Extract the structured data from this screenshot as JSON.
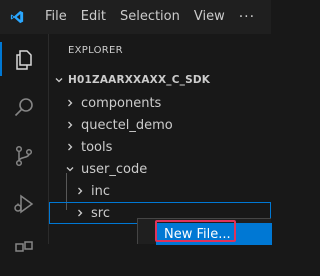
{
  "titlebar": {
    "menu": [
      "File",
      "Edit",
      "Selection",
      "View"
    ],
    "more": "···"
  },
  "activity_bar": {
    "icons": [
      "explorer-icon",
      "search-icon",
      "source-control-icon",
      "run-debug-icon",
      "extensions-icon"
    ]
  },
  "explorer": {
    "title": "EXPLORER",
    "root": "H01ZAARXXAXX_C_SDK",
    "items": [
      {
        "label": "components"
      },
      {
        "label": "quectel_demo"
      },
      {
        "label": "tools"
      },
      {
        "label": "user_code"
      },
      {
        "label": "inc"
      },
      {
        "label": "src"
      }
    ]
  },
  "context_menu": {
    "new_file": "New File..."
  },
  "colors": {
    "accent": "#0078d4",
    "highlight": "#e0335a",
    "background": "#181818"
  }
}
